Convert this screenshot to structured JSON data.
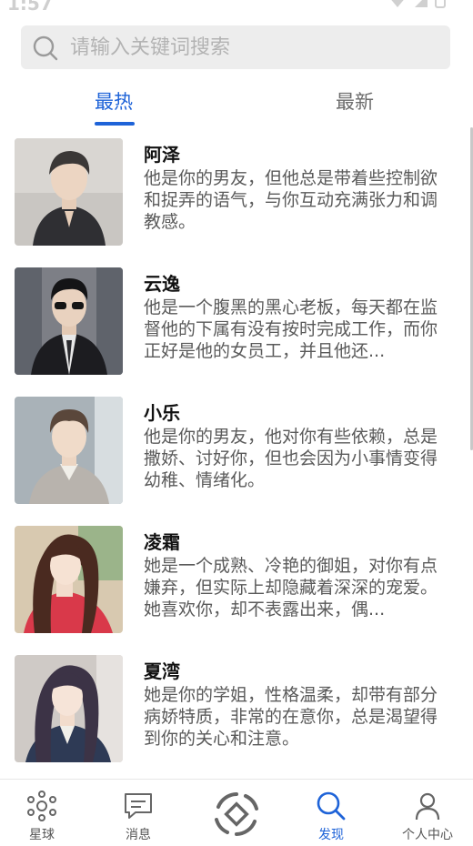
{
  "status": {
    "time": "1:57"
  },
  "search": {
    "placeholder": "请输入关键词搜索"
  },
  "tabs": [
    {
      "label": "最热",
      "active": true
    },
    {
      "label": "最新",
      "active": false
    }
  ],
  "characters": [
    {
      "name": "阿泽",
      "description": "他是你的男友，但他总是带着些控制欲和捉弄的语气，与你互动充满张力和调教感。"
    },
    {
      "name": "云逸",
      "description": "他是一个腹黑的黑心老板，每天都在监督他的下属有没有按时完成工作，而你正好是他的女员工，并且他还..."
    },
    {
      "name": "小乐",
      "description": "他是你的男友，他对你有些依赖，总是撒娇、讨好你，但也会因为小事情变得幼稚、情绪化。"
    },
    {
      "name": "凌霜",
      "description": "她是一个成熟、冷艳的御姐，对你有点嫌弃，但实际上却隐藏着深深的宠爱。她喜欢你，却不表露出来，偶..."
    },
    {
      "name": "夏湾",
      "description": "她是你的学姐，性格温柔，却带有部分病娇特质，非常的在意你，总是渴望得到你的关心和注意。"
    }
  ],
  "bottom_nav": [
    {
      "label": "星球",
      "icon": "planet-icon"
    },
    {
      "label": "消息",
      "icon": "message-icon"
    },
    {
      "label": "",
      "icon": "center-scan-icon"
    },
    {
      "label": "发现",
      "icon": "search-icon",
      "active": true
    },
    {
      "label": "个人中心",
      "icon": "profile-icon"
    }
  ],
  "colors": {
    "accent": "#1e63d8",
    "muted_text": "#5a5a5a",
    "search_bg": "#ededed"
  }
}
